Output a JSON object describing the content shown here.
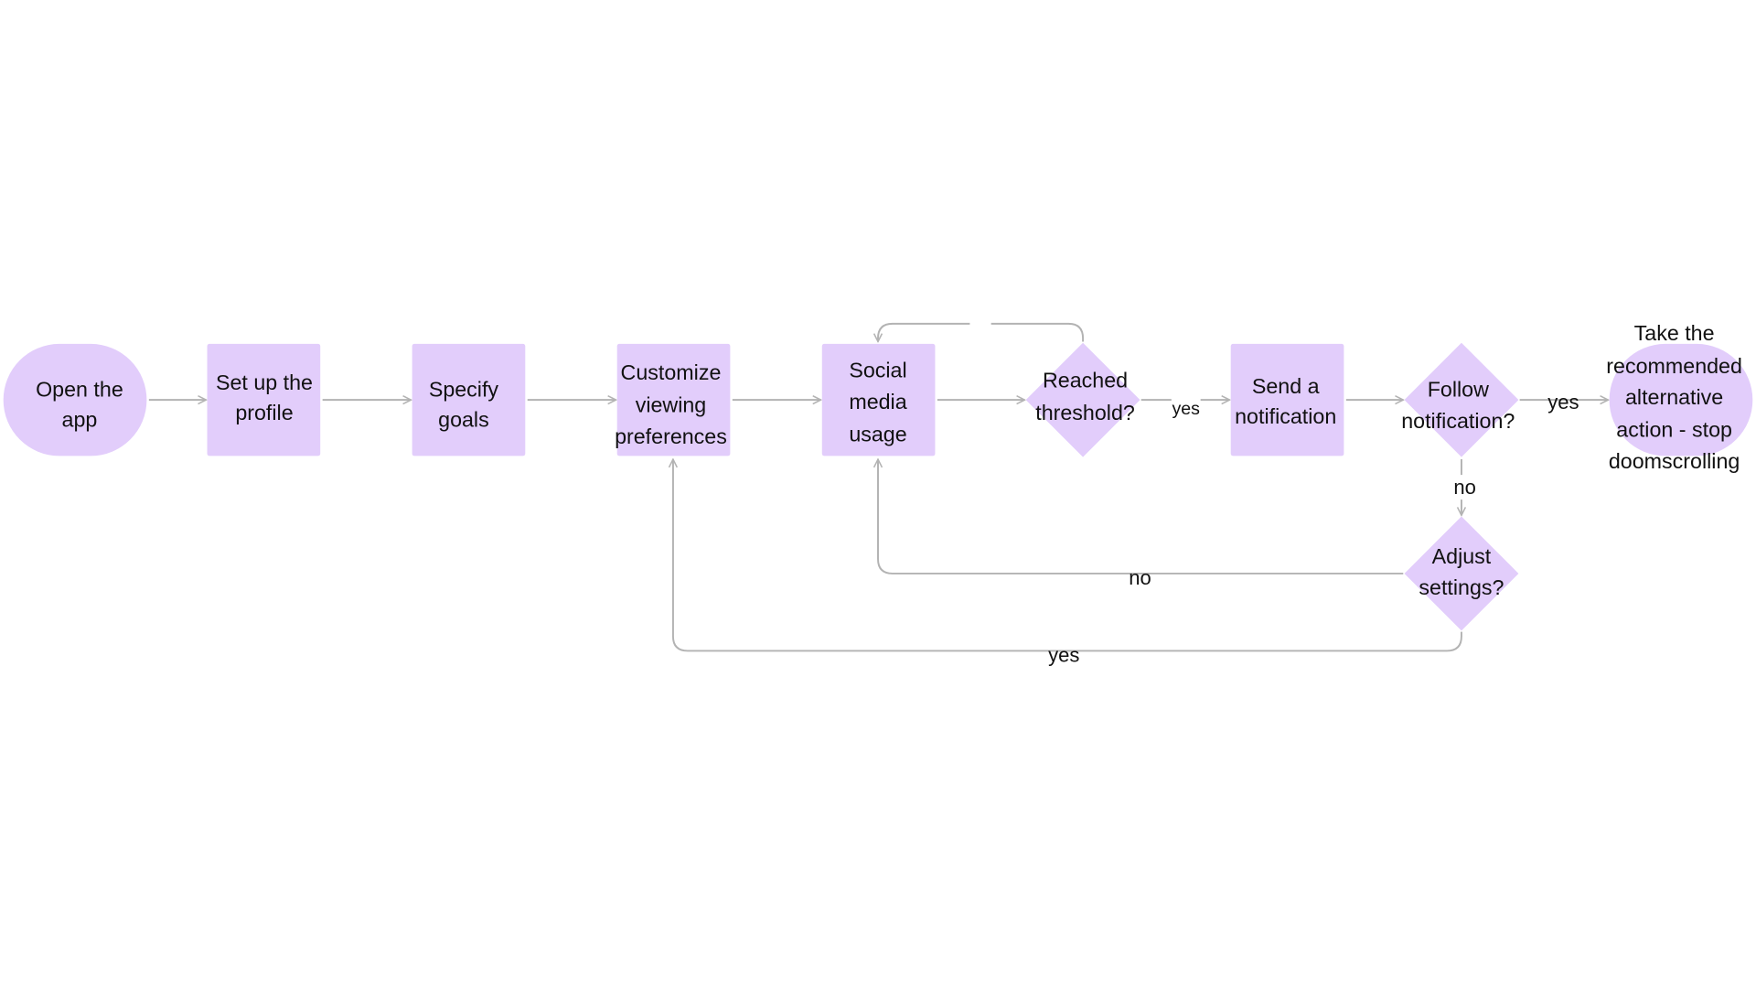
{
  "colors": {
    "node_fill": "#e2cdfb",
    "edge": "#b3b3b3",
    "text": "#111111"
  },
  "nodes": {
    "open_app": {
      "shape": "terminal",
      "lines": [
        "Open the",
        "app"
      ]
    },
    "setup_profile": {
      "shape": "process",
      "lines": [
        "Set up the",
        "profile"
      ]
    },
    "specify_goals": {
      "shape": "process",
      "lines": [
        "Specify",
        "goals"
      ]
    },
    "customize": {
      "shape": "process",
      "lines": [
        "Customize",
        "viewing",
        "preferences"
      ]
    },
    "social_media": {
      "shape": "process",
      "lines": [
        "Social",
        "media",
        "usage"
      ]
    },
    "reached_threshold": {
      "shape": "decision",
      "lines": [
        "Reached",
        "threshold?"
      ]
    },
    "send_notification": {
      "shape": "process",
      "lines": [
        "Send a",
        "notification"
      ]
    },
    "follow_notification": {
      "shape": "decision",
      "lines": [
        "Follow",
        "notification?"
      ]
    },
    "take_action": {
      "shape": "terminal",
      "lines": [
        "Take the",
        "recommended",
        "alternative",
        "action - stop",
        "doomscrolling"
      ]
    },
    "adjust_settings": {
      "shape": "decision",
      "lines": [
        "Adjust",
        "settings?"
      ]
    }
  },
  "edges": {
    "threshold_yes": "yes",
    "follow_yes": "yes",
    "follow_no": "no",
    "adjust_no": "no",
    "adjust_yes": "yes",
    "threshold_loop": ""
  }
}
